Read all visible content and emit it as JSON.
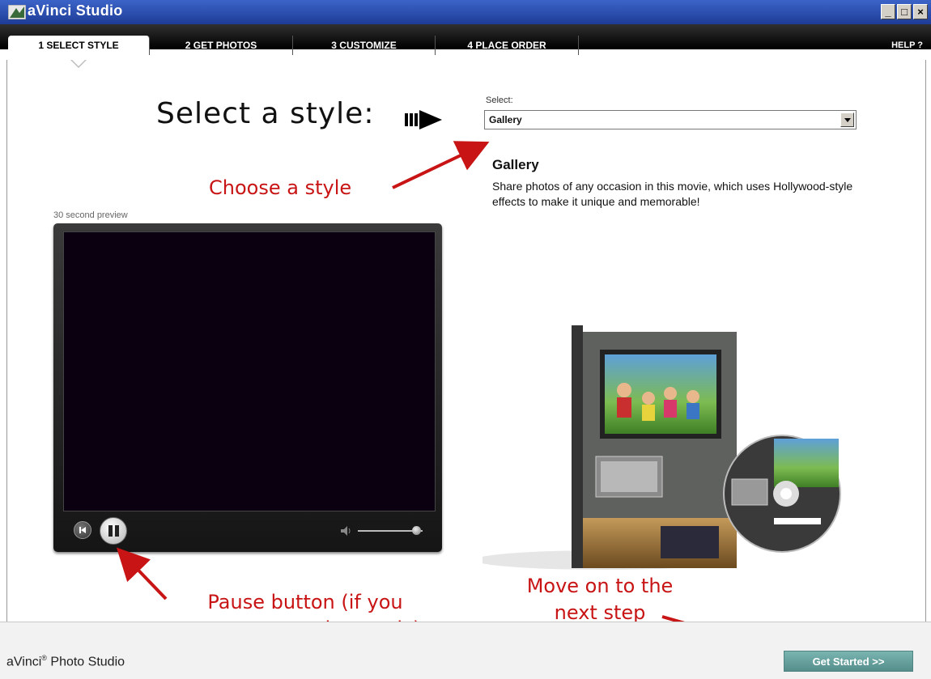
{
  "window": {
    "title": "aVinci Studio"
  },
  "tabs": [
    {
      "label": "1 SELECT STYLE"
    },
    {
      "label": "2 GET PHOTOS"
    },
    {
      "label": "3 CUSTOMIZE"
    },
    {
      "label": "4 PLACE ORDER"
    }
  ],
  "help_label": "HELP ?",
  "main": {
    "heading": "Select a style:",
    "select_label": "Select:",
    "select_value": "Gallery",
    "style_name": "Gallery",
    "style_description": "Share photos of any occasion in this movie, which uses Hollywood-style effects to make it unique and memorable!",
    "preview_label": "30 second preview"
  },
  "player": {
    "volume_level": 0.9
  },
  "annotations": {
    "choose_style": "Choose a style",
    "pause_button": "Pause button (if you want to stop the music)",
    "next_step": "Move on to the next step"
  },
  "footer": {
    "brand": "aVinci",
    "brand_suffix": "Photo Studio",
    "get_started_label": "Get Started >>"
  },
  "colors": {
    "accent_red": "#c81414",
    "titlebar_blue": "#1e3c96",
    "button_teal": "#5f9a97"
  }
}
